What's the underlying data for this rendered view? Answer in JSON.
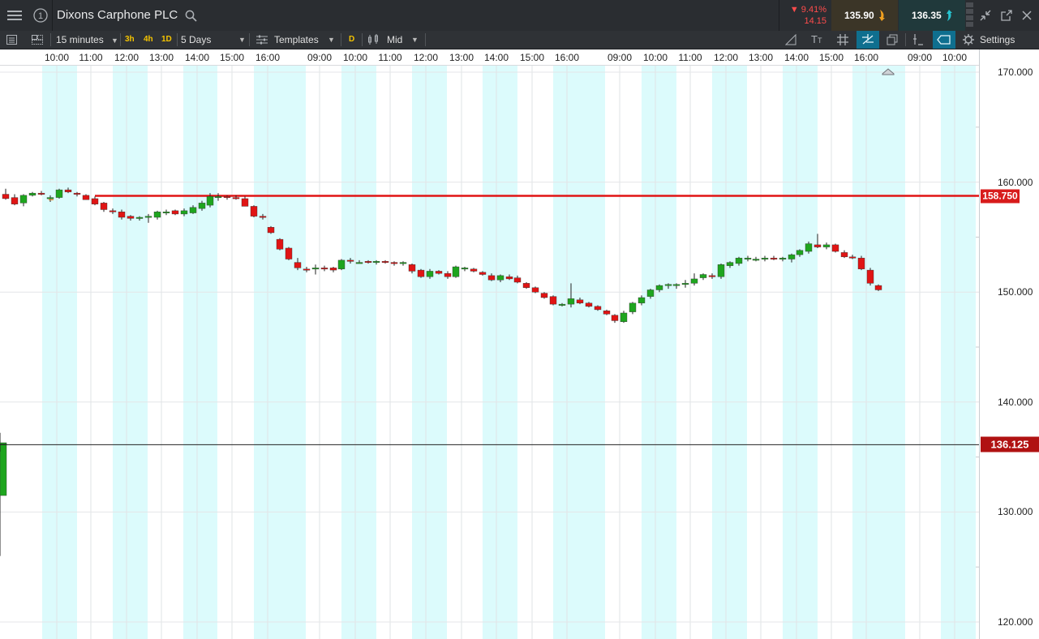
{
  "header": {
    "title": "Dixons Carphone PLC",
    "change_pct": "▼ 9.41%",
    "change_abs": "14.15",
    "sell_price": "135.90",
    "buy_price": "136.35"
  },
  "toolbar": {
    "interval": "15 minutes",
    "quick": [
      "3h",
      "4h",
      "1D"
    ],
    "range": "5 Days",
    "templates": "Templates",
    "d_badge": "D",
    "price_type": "Mid",
    "settings": "Settings"
  },
  "time_axis": [
    "10:00",
    "11:00",
    "12:00",
    "13:00",
    "14:00",
    "15:00",
    "16:00",
    "09:00",
    "10:00",
    "11:00",
    "12:00",
    "13:00",
    "14:00",
    "15:00",
    "16:00",
    "09:00",
    "10:00",
    "11:00",
    "12:00",
    "13:00",
    "14:00",
    "15:00",
    "16:00",
    "09:00",
    "10:00"
  ],
  "price_axis": [
    "170.000",
    "160.000",
    "150.000",
    "140.000",
    "130.000",
    "120.000"
  ],
  "markers": {
    "hline_label": "158.750",
    "crosshair_label": "136.125"
  },
  "colors": {
    "up": "#1ea51e",
    "down": "#e01414",
    "hline": "#e01414",
    "session_shade": "#dcfbfc",
    "crosshair": "#222222"
  },
  "chart_data": {
    "type": "candlestick",
    "title": "",
    "ylim": [
      120,
      170
    ],
    "hline": 158.75,
    "crosshair_y": 136.125,
    "ohlc": [
      [
        158.9,
        159.4,
        158.4,
        158.5
      ],
      [
        158.6,
        158.9,
        157.9,
        158.0
      ],
      [
        158.1,
        158.9,
        157.8,
        158.8
      ],
      [
        158.8,
        159.1,
        158.7,
        159.0
      ],
      [
        159.0,
        159.2,
        158.8,
        158.9
      ],
      [
        158.6,
        158.8,
        158.2,
        158.6
      ],
      [
        158.6,
        159.4,
        158.5,
        159.3
      ],
      [
        159.3,
        159.5,
        159.0,
        159.1
      ],
      [
        159.0,
        159.1,
        158.7,
        158.9
      ],
      [
        158.8,
        158.9,
        158.4,
        158.4
      ],
      [
        158.5,
        158.7,
        157.9,
        158.0
      ],
      [
        158.1,
        158.2,
        157.3,
        157.5
      ],
      [
        157.4,
        157.6,
        157.1,
        157.3
      ],
      [
        157.3,
        157.5,
        156.6,
        156.8
      ],
      [
        156.9,
        157.0,
        156.5,
        156.7
      ],
      [
        156.7,
        156.9,
        156.5,
        156.8
      ],
      [
        156.8,
        157.1,
        156.3,
        156.9
      ],
      [
        156.8,
        157.4,
        156.6,
        157.3
      ],
      [
        157.2,
        157.5,
        157.0,
        157.3
      ],
      [
        157.4,
        157.5,
        157.0,
        157.1
      ],
      [
        157.1,
        157.6,
        156.9,
        157.4
      ],
      [
        157.2,
        157.9,
        157.1,
        157.7
      ],
      [
        157.6,
        158.3,
        157.4,
        158.1
      ],
      [
        157.9,
        159.0,
        157.7,
        158.7
      ],
      [
        158.6,
        159.0,
        158.3,
        158.7
      ],
      [
        158.7,
        158.8,
        158.4,
        158.6
      ],
      [
        158.6,
        158.8,
        158.4,
        158.5
      ],
      [
        158.5,
        158.7,
        157.8,
        157.8
      ],
      [
        157.8,
        157.9,
        156.8,
        156.9
      ],
      [
        156.9,
        157.1,
        156.6,
        156.8
      ],
      [
        155.9,
        156.0,
        155.3,
        155.4
      ],
      [
        154.8,
        154.9,
        153.8,
        153.9
      ],
      [
        154.0,
        154.1,
        152.9,
        153.0
      ],
      [
        152.7,
        153.1,
        152.0,
        152.2
      ],
      [
        152.1,
        152.3,
        151.8,
        152.0
      ],
      [
        152.1,
        152.5,
        151.6,
        152.2
      ],
      [
        152.2,
        152.4,
        151.9,
        152.1
      ],
      [
        152.2,
        152.3,
        151.8,
        152.0
      ],
      [
        152.1,
        153.0,
        152.0,
        152.9
      ],
      [
        152.9,
        153.1,
        152.6,
        152.8
      ],
      [
        152.7,
        152.9,
        152.6,
        152.7
      ],
      [
        152.8,
        152.9,
        152.6,
        152.7
      ],
      [
        152.7,
        152.9,
        152.5,
        152.8
      ],
      [
        152.8,
        152.9,
        152.6,
        152.7
      ],
      [
        152.7,
        152.8,
        152.4,
        152.6
      ],
      [
        152.6,
        152.8,
        152.4,
        152.7
      ],
      [
        152.5,
        152.6,
        151.7,
        151.9
      ],
      [
        152.0,
        152.1,
        151.3,
        151.4
      ],
      [
        151.4,
        152.1,
        151.2,
        151.9
      ],
      [
        151.9,
        152.0,
        151.6,
        151.7
      ],
      [
        151.7,
        151.9,
        151.2,
        151.4
      ],
      [
        151.4,
        152.4,
        151.3,
        152.3
      ],
      [
        152.2,
        152.3,
        151.9,
        152.2
      ],
      [
        152.1,
        152.2,
        151.8,
        151.9
      ],
      [
        151.8,
        151.9,
        151.5,
        151.6
      ],
      [
        151.5,
        151.7,
        151.0,
        151.1
      ],
      [
        151.1,
        151.6,
        150.9,
        151.5
      ],
      [
        151.4,
        151.6,
        151.1,
        151.2
      ],
      [
        151.3,
        151.5,
        150.8,
        150.9
      ],
      [
        150.8,
        150.9,
        150.3,
        150.4
      ],
      [
        150.4,
        150.5,
        149.9,
        150.0
      ],
      [
        149.9,
        150.0,
        149.4,
        149.5
      ],
      [
        149.6,
        149.7,
        148.8,
        148.9
      ],
      [
        148.9,
        149.0,
        148.7,
        148.9
      ],
      [
        148.9,
        150.8,
        148.6,
        149.4
      ],
      [
        149.3,
        149.5,
        148.9,
        149.0
      ],
      [
        149.0,
        149.1,
        148.6,
        148.7
      ],
      [
        148.7,
        148.8,
        148.3,
        148.4
      ],
      [
        148.3,
        148.4,
        147.9,
        148.0
      ],
      [
        147.9,
        148.0,
        147.2,
        147.4
      ],
      [
        147.3,
        148.3,
        147.2,
        148.1
      ],
      [
        148.2,
        149.1,
        148.0,
        149.0
      ],
      [
        149.0,
        149.7,
        148.8,
        149.5
      ],
      [
        149.6,
        150.3,
        149.4,
        150.2
      ],
      [
        150.2,
        150.7,
        150.0,
        150.6
      ],
      [
        150.6,
        150.8,
        150.3,
        150.7
      ],
      [
        150.6,
        150.8,
        150.3,
        150.7
      ],
      [
        150.7,
        151.1,
        150.4,
        150.8
      ],
      [
        150.8,
        151.7,
        150.6,
        151.2
      ],
      [
        151.3,
        151.7,
        151.1,
        151.6
      ],
      [
        151.5,
        151.7,
        151.2,
        151.4
      ],
      [
        151.4,
        152.6,
        151.2,
        152.5
      ],
      [
        152.4,
        152.8,
        152.2,
        152.7
      ],
      [
        152.6,
        153.2,
        152.4,
        153.1
      ],
      [
        153.0,
        153.3,
        152.8,
        153.1
      ],
      [
        153.0,
        153.2,
        152.8,
        153.0
      ],
      [
        153.0,
        153.3,
        152.8,
        153.1
      ],
      [
        153.1,
        153.3,
        152.9,
        153.0
      ],
      [
        153.0,
        153.2,
        152.8,
        153.1
      ],
      [
        153.0,
        153.5,
        152.7,
        153.4
      ],
      [
        153.4,
        153.9,
        153.2,
        153.8
      ],
      [
        153.7,
        154.6,
        153.5,
        154.4
      ],
      [
        154.3,
        155.3,
        154.0,
        154.1
      ],
      [
        154.1,
        154.5,
        153.9,
        154.3
      ],
      [
        154.3,
        154.4,
        153.6,
        153.7
      ],
      [
        153.6,
        153.8,
        153.1,
        153.2
      ],
      [
        153.2,
        153.4,
        153.0,
        153.1
      ],
      [
        153.1,
        153.3,
        152.0,
        152.1
      ],
      [
        152.0,
        152.2,
        150.6,
        150.8
      ],
      [
        150.6,
        150.7,
        150.1,
        150.2
      ],
      [
        131.5,
        137.2,
        126.0,
        136.2
      ],
      [
        136.2,
        136.7,
        135.5,
        136.3
      ]
    ],
    "candle_x": [
      7,
      18,
      29,
      40,
      51,
      62,
      73,
      84,
      95,
      106,
      117,
      128,
      139,
      150,
      161,
      172,
      183,
      194,
      205,
      216,
      227,
      238,
      249,
      259,
      269,
      280,
      291,
      302,
      313,
      324,
      334,
      345,
      356,
      367,
      378,
      389,
      400,
      411,
      421,
      432,
      443,
      454,
      464,
      475,
      486,
      497,
      508,
      519,
      530,
      541,
      552,
      562,
      573,
      584,
      595,
      606,
      617,
      628,
      638,
      649,
      660,
      671,
      682,
      693,
      704,
      715,
      726,
      737,
      748,
      758,
      769,
      780,
      791,
      802,
      813,
      824,
      834,
      845,
      856,
      867,
      878,
      889,
      900,
      911,
      922,
      932,
      943,
      954,
      965,
      976,
      986,
      997,
      1008,
      1019,
      1030,
      1041,
      1051,
      1062,
      1073,
      1083
    ],
    "sessions": [
      [
        52,
        95
      ],
      [
        139,
        182
      ],
      [
        226,
        268
      ],
      [
        313,
        377
      ],
      [
        421,
        464
      ],
      [
        508,
        551
      ],
      [
        595,
        638
      ],
      [
        682,
        746
      ],
      [
        791,
        834
      ],
      [
        878,
        921
      ],
      [
        965,
        1008
      ],
      [
        1051,
        1116
      ],
      [
        1160,
        1203
      ]
    ]
  }
}
